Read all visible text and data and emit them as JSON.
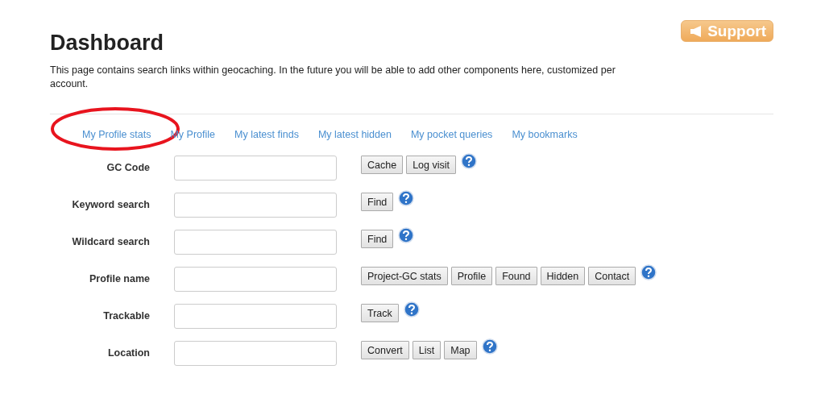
{
  "support_button": "Support",
  "title": "Dashboard",
  "description": "This page contains search links within geocaching. In the future you will be able to add other components here, customized per account.",
  "links": [
    {
      "label": "My Profile stats"
    },
    {
      "label": "My Profile"
    },
    {
      "label": "My latest finds"
    },
    {
      "label": "My latest hidden"
    },
    {
      "label": "My pocket queries"
    },
    {
      "label": "My bookmarks"
    }
  ],
  "rows": [
    {
      "label": "GC Code",
      "buttons": [
        "Cache",
        "Log visit"
      ]
    },
    {
      "label": "Keyword search",
      "buttons": [
        "Find"
      ]
    },
    {
      "label": "Wildcard search",
      "buttons": [
        "Find"
      ]
    },
    {
      "label": "Profile name",
      "buttons": [
        "Project-GC stats",
        "Profile",
        "Found",
        "Hidden",
        "Contact"
      ]
    },
    {
      "label": "Trackable",
      "buttons": [
        "Track"
      ]
    },
    {
      "label": "Location",
      "buttons": [
        "Convert",
        "List",
        "Map"
      ]
    }
  ]
}
